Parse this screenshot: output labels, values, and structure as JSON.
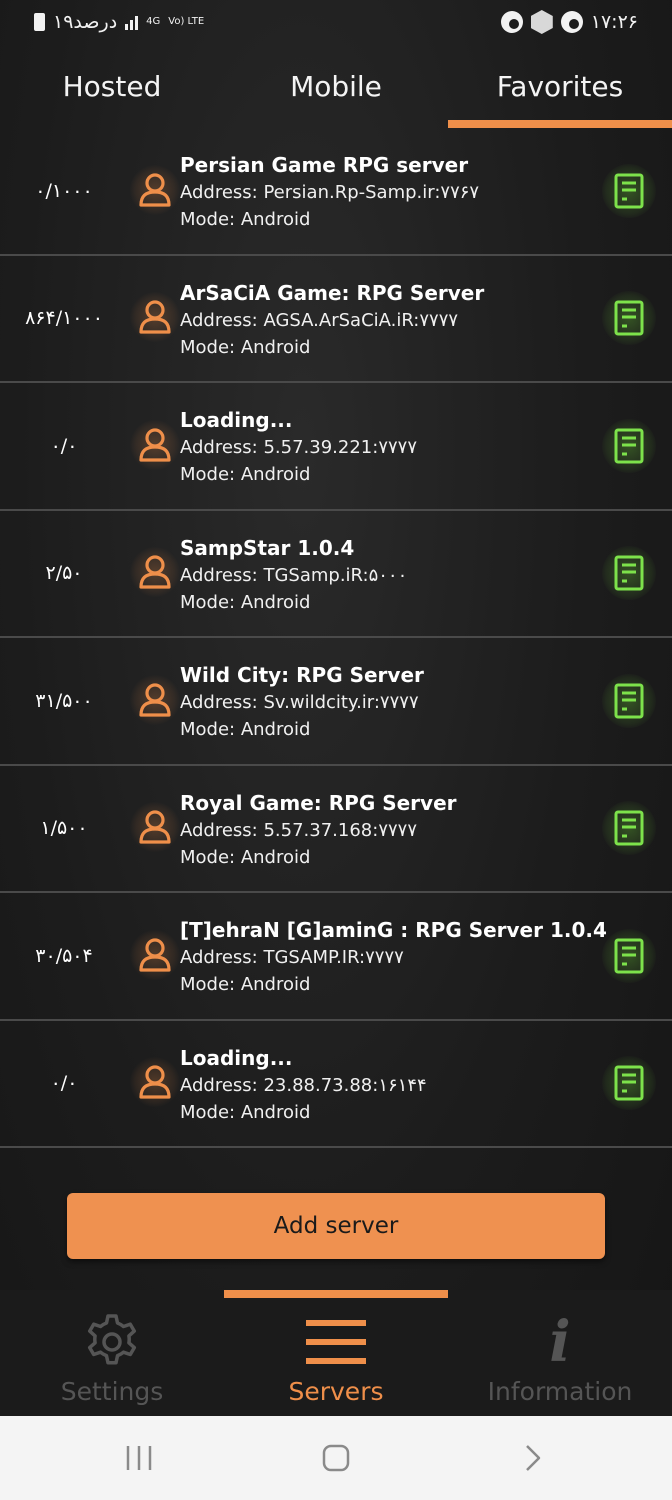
{
  "status_bar": {
    "battery_text": "۱۹درصد",
    "network": "4G",
    "volte": "Vo) LTE",
    "time": "۱۷:۲۶"
  },
  "tabs": [
    {
      "label": "Hosted",
      "active": false
    },
    {
      "label": "Mobile",
      "active": false
    },
    {
      "label": "Favorites",
      "active": true
    }
  ],
  "servers": [
    {
      "players": "۰/۱۰۰۰",
      "name": "Persian Game RPG server",
      "address": "Address: Persian.Rp-Samp.ir:۷۷۶۷",
      "mode": "Mode: Android"
    },
    {
      "players": "۸۶۴/۱۰۰۰",
      "name": "ArSaCiA Game: RPG Server",
      "address": "Address: AGSA.ArSaCiA.iR:۷۷۷۷",
      "mode": "Mode: Android"
    },
    {
      "players": "۰/۰",
      "name": "Loading...",
      "address": "Address: 5.57.39.221:۷۷۷۷",
      "mode": "Mode: Android"
    },
    {
      "players": "۲/۵۰",
      "name": "SampStar 1.0.4",
      "address": "Address: TGSamp.iR:۵۰۰۰",
      "mode": "Mode: Android"
    },
    {
      "players": "۳۱/۵۰۰",
      "name": "Wild City: RPG Server",
      "address": "Address: Sv.wildcity.ir:۷۷۷۷",
      "mode": "Mode: Android"
    },
    {
      "players": "۱/۵۰۰",
      "name": "Royal Game: RPG Server",
      "address": "Address: 5.57.37.168:۷۷۷۷",
      "mode": "Mode: Android"
    },
    {
      "players": "۳۰/۵۰۴",
      "name": "[T]ehraN [G]aminG : RPG Server 1.0.4",
      "address": "Address: TGSAMP.IR:۷۷۷۷",
      "mode": "Mode: Android"
    },
    {
      "players": "۰/۰",
      "name": "Loading...",
      "address": "Address: 23.88.73.88:۱۶۱۴۴",
      "mode": "Mode: Android"
    }
  ],
  "add_server_label": "Add server",
  "bottom_nav": [
    {
      "label": "Settings",
      "icon": "gear-icon",
      "active": false
    },
    {
      "label": "Servers",
      "icon": "menu-icon",
      "active": true
    },
    {
      "label": "Information",
      "icon": "info-icon",
      "active": false
    }
  ],
  "colors": {
    "accent": "#ef8f4a",
    "server_icon": "#7de24b",
    "background": "#1c1c1c"
  }
}
